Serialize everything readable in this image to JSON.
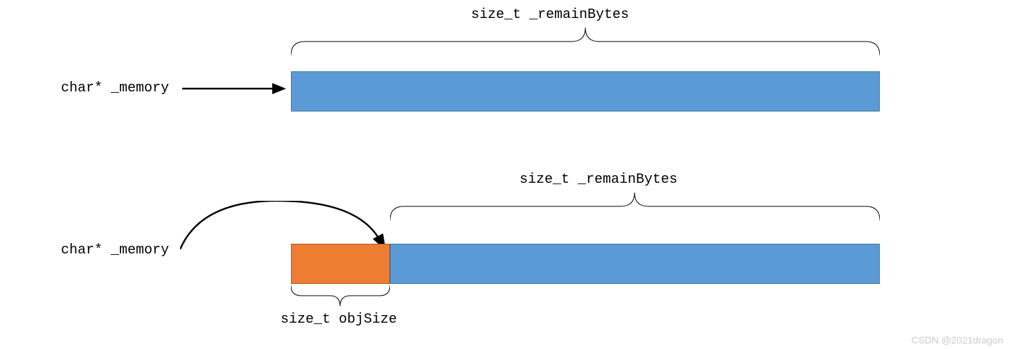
{
  "diagram1": {
    "pointerLabel": "char* _memory",
    "braceLabel": "size_t _remainBytes"
  },
  "diagram2": {
    "pointerLabel": "char* _memory",
    "braceLabel": "size_t _remainBytes",
    "objLabel": "size_t objSize"
  },
  "watermark": "CSDN @2021dragon",
  "colors": {
    "blue": "#5b9bd5",
    "blueBorder": "#41719c",
    "orange": "#ed7d31",
    "orangeBorder": "#ae5a21"
  }
}
